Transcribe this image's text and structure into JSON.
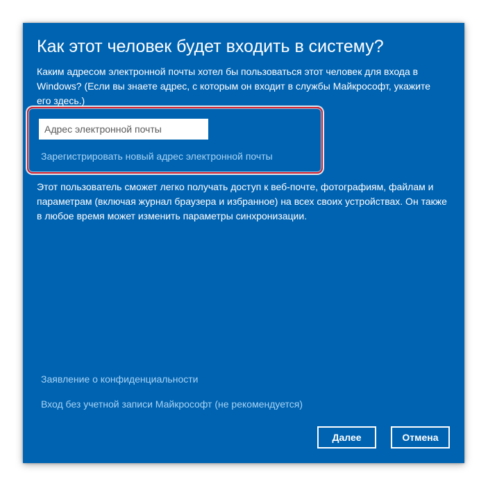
{
  "dialog": {
    "title": "Как этот человек будет входить в систему?",
    "description": "Каким адресом электронной почты хотел бы пользоваться этот человек для входа в Windows? (Если вы знаете адрес, с которым он входит в службы Майкрософт, укажите его здесь.)",
    "email_input": {
      "value": "",
      "placeholder": "Адрес электронной почты"
    },
    "register_link": "Зарегистрировать новый адрес электронной почты",
    "info": "Этот пользователь сможет легко получать доступ к веб-почте, фотографиям, файлам и параметрам (включая журнал браузера и избранное) на всех своих устройствах. Он также в любое время может изменить параметры синхронизации.",
    "privacy_link": "Заявление о конфиденциальности",
    "no_account_link": "Вход без учетной записи Майкрософт (не рекомендуется)",
    "buttons": {
      "next": "Далее",
      "cancel": "Отмена"
    }
  },
  "colors": {
    "dialog_background": "#0063b1",
    "link": "#a6d3f5",
    "highlight_border": "#d8202c"
  }
}
